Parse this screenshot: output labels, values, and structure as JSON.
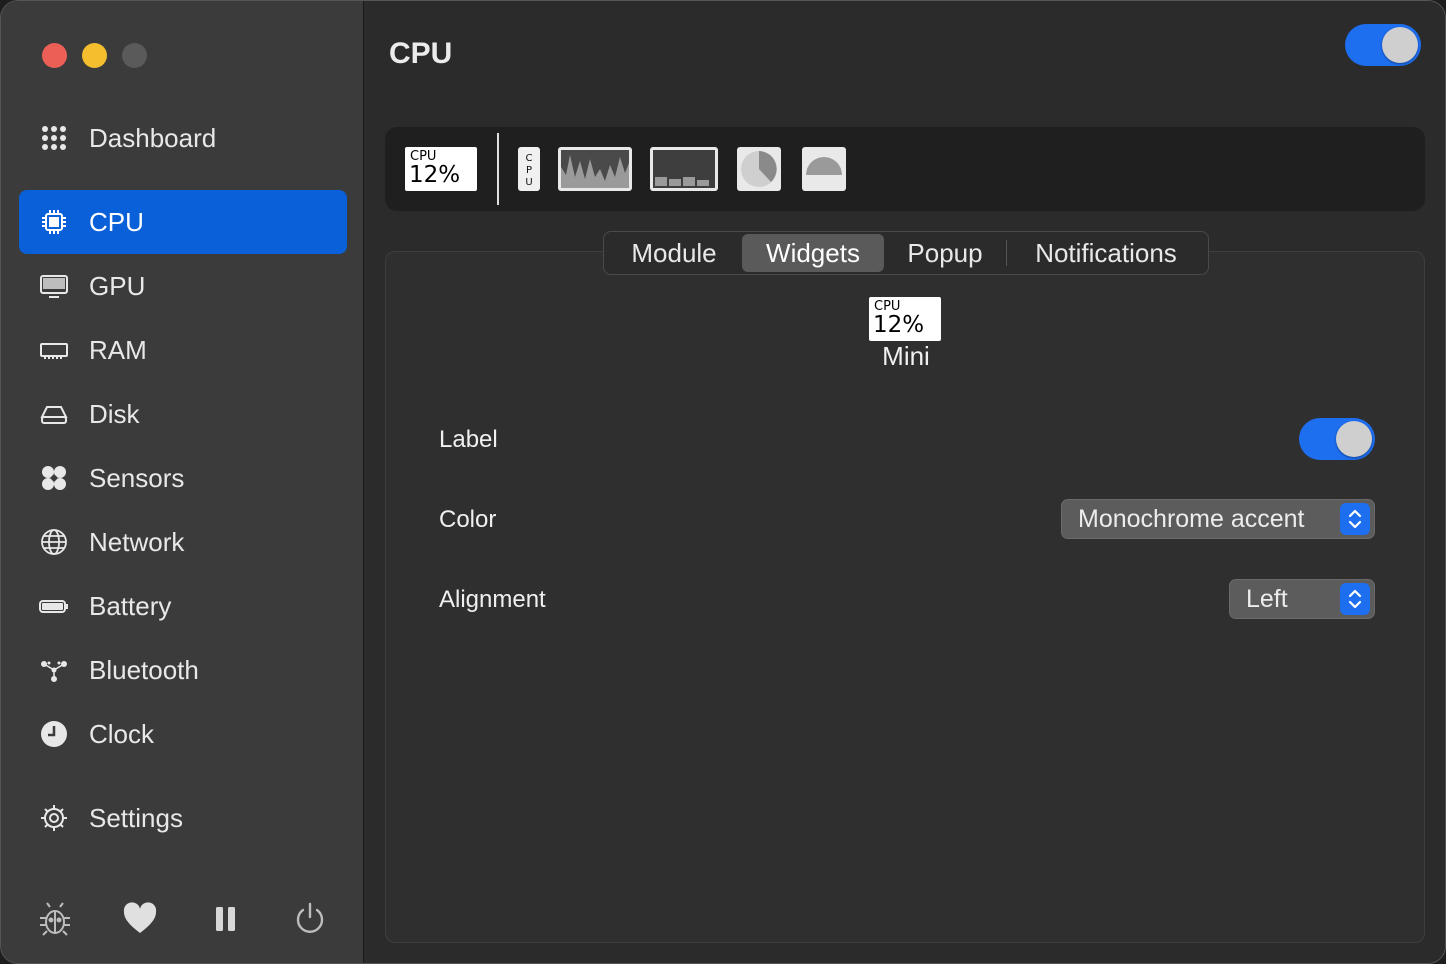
{
  "window": {
    "title": "CPU"
  },
  "sidebar": {
    "items": [
      {
        "label": "Dashboard",
        "icon": "grid-icon",
        "active": false
      },
      {
        "label": "CPU",
        "icon": "cpu-chip-icon",
        "active": true
      },
      {
        "label": "GPU",
        "icon": "monitor-icon",
        "active": false
      },
      {
        "label": "RAM",
        "icon": "memory-icon",
        "active": false
      },
      {
        "label": "Disk",
        "icon": "disk-drive-icon",
        "active": false
      },
      {
        "label": "Sensors",
        "icon": "fan-icon",
        "active": false
      },
      {
        "label": "Network",
        "icon": "globe-icon",
        "active": false
      },
      {
        "label": "Battery",
        "icon": "battery-icon",
        "active": false
      },
      {
        "label": "Bluetooth",
        "icon": "bluetooth-nodes-icon",
        "active": false
      },
      {
        "label": "Clock",
        "icon": "clock-icon",
        "active": false
      },
      {
        "label": "Settings",
        "icon": "gear-icon",
        "active": false
      }
    ],
    "footer_icons": [
      "bug-icon",
      "heart-icon",
      "pause-icon",
      "power-icon"
    ]
  },
  "header": {
    "enabled": true
  },
  "widget_bar": {
    "mini": {
      "line1": "CPU",
      "line2": "12%"
    },
    "widgets": [
      "mini",
      "label-vertical",
      "line-chart",
      "bar-chart",
      "pie-chart",
      "speedometer"
    ],
    "vertical_label": "CPU"
  },
  "tabs": [
    {
      "label": "Module",
      "selected": false
    },
    {
      "label": "Widgets",
      "selected": true
    },
    {
      "label": "Popup",
      "selected": false
    },
    {
      "label": "Notifications",
      "selected": false
    }
  ],
  "preview": {
    "line1": "CPU",
    "line2": "12%",
    "caption": "Mini"
  },
  "settings": {
    "label": {
      "title": "Label",
      "enabled": true
    },
    "color": {
      "title": "Color",
      "value": "Monochrome accent"
    },
    "alignment": {
      "title": "Alignment",
      "value": "Left"
    }
  },
  "colors": {
    "accent": "#1e6ef0",
    "active_nav": "#0a60d9",
    "close": "#ec5f57",
    "minimize": "#f4be2f"
  }
}
